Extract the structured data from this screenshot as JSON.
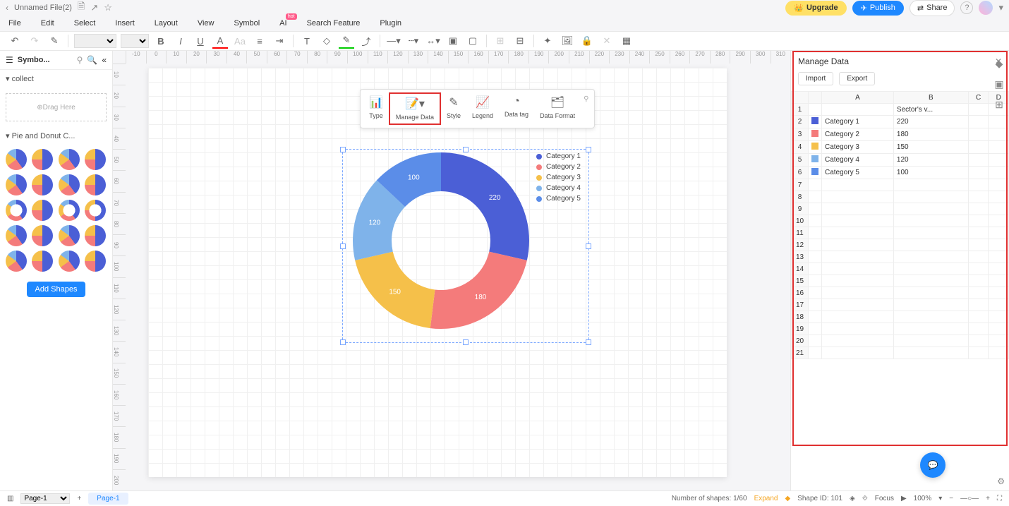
{
  "titlebar": {
    "filename": "Unnamed File(2)",
    "upgrade": "Upgrade",
    "publish": "Publish",
    "share": "Share"
  },
  "menu": {
    "file": "File",
    "edit": "Edit",
    "select": "Select",
    "insert": "Insert",
    "layout": "Layout",
    "view": "View",
    "symbol": "Symbol",
    "ai": "AI",
    "ai_badge": "hot",
    "search": "Search Feature",
    "plugin": "Plugin"
  },
  "leftpanel": {
    "lib_label": "Symbo...",
    "collect": "collect",
    "drag_here": "Drag Here",
    "pie_section": "Pie and Donut C...",
    "add_shapes": "Add Shapes"
  },
  "chart_toolbar": {
    "type": "Type",
    "manage_data": "Manage Data",
    "style": "Style",
    "legend": "Legend",
    "data_tag": "Data tag",
    "data_format": "Data Format"
  },
  "chart_data": {
    "type": "pie",
    "title": "Sector's v...",
    "series": [
      {
        "name": "Category 1",
        "value": 220,
        "color": "#4b5fd6"
      },
      {
        "name": "Category 2",
        "value": 180,
        "color": "#f47b7b"
      },
      {
        "name": "Category 3",
        "value": 150,
        "color": "#f5c04a"
      },
      {
        "name": "Category 4",
        "value": 120,
        "color": "#7fb3ea"
      },
      {
        "name": "Category 5",
        "value": 100,
        "color": "#5b8de8"
      }
    ]
  },
  "manage_data": {
    "title": "Manage Data",
    "import": "Import",
    "export": "Export",
    "columns": [
      "A",
      "B",
      "C",
      "D"
    ],
    "header_row": "Sector's v...",
    "colors": [
      "#4b5fd6",
      "#f47b7b",
      "#f5c04a",
      "#7fb3ea",
      "#5b8de8"
    ]
  },
  "statusbar": {
    "page_select": "Page-1",
    "page_tab": "Page-1",
    "shapes_count": "Number of shapes: 1/60",
    "expand": "Expand",
    "shape_id": "Shape ID: 101",
    "focus": "Focus",
    "zoom": "100%"
  },
  "ruler": {
    "h": [
      "-10",
      "0",
      "10",
      "20",
      "30",
      "40",
      "50",
      "60",
      "70",
      "80",
      "90",
      "100",
      "110",
      "120",
      "130",
      "140",
      "150",
      "160",
      "170",
      "180",
      "190",
      "200",
      "210",
      "220",
      "230",
      "240",
      "250",
      "260",
      "270",
      "280",
      "290",
      "300",
      "310"
    ],
    "v": [
      "10",
      "20",
      "30",
      "40",
      "50",
      "60",
      "70",
      "80",
      "90",
      "100",
      "110",
      "120",
      "130",
      "140",
      "150",
      "160",
      "170",
      "180",
      "190",
      "200"
    ]
  }
}
